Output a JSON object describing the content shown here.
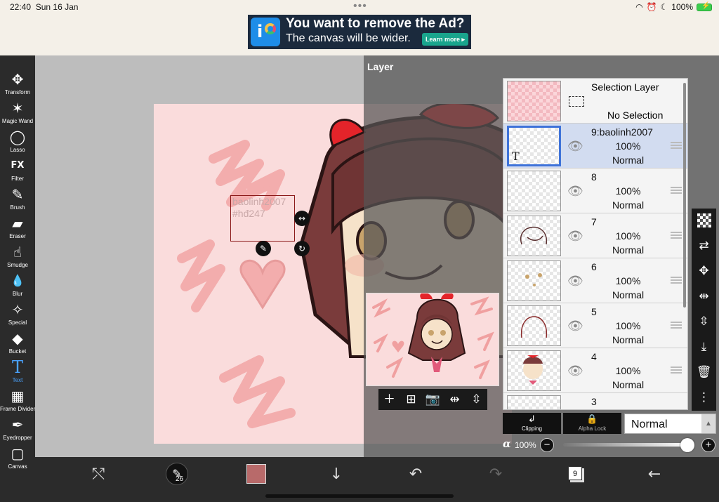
{
  "status": {
    "time": "22:40",
    "date": "Sun 16 Jan",
    "battery": "100%"
  },
  "ad": {
    "title": "You want to remove the Ad?",
    "subtitle": "The canvas will be wider.",
    "button": "Learn more ▸"
  },
  "tools": [
    {
      "label": "Transform",
      "icon": "✥"
    },
    {
      "label": "Magic Wand",
      "icon": "✶"
    },
    {
      "label": "Lasso",
      "icon": "◯"
    },
    {
      "label": "Filter",
      "icon": "FX"
    },
    {
      "label": "Brush",
      "icon": "✎"
    },
    {
      "label": "Eraser",
      "icon": "▰"
    },
    {
      "label": "Smudge",
      "icon": "☝"
    },
    {
      "label": "Blur",
      "icon": "💧"
    },
    {
      "label": "Special",
      "icon": "✧"
    },
    {
      "label": "Bucket",
      "icon": "◆"
    },
    {
      "label": "Text",
      "icon": "T"
    },
    {
      "label": "Frame Divider",
      "icon": "▦"
    },
    {
      "label": "Eyedropper",
      "icon": "✒"
    },
    {
      "label": "Canvas",
      "icon": "▢"
    }
  ],
  "canvas": {
    "text_line1": "baolinh2007",
    "text_line2": "#hđ247"
  },
  "layer_panel": {
    "title": "Layer",
    "selection_layer": {
      "name": "Selection Layer",
      "state": "No Selection"
    },
    "layers": [
      {
        "name": "9:baolinh2007",
        "opacity": "100%",
        "blend": "Normal"
      },
      {
        "name": "8",
        "opacity": "100%",
        "blend": "Normal"
      },
      {
        "name": "7",
        "opacity": "100%",
        "blend": "Normal"
      },
      {
        "name": "6",
        "opacity": "100%",
        "blend": "Normal"
      },
      {
        "name": "5",
        "opacity": "100%",
        "blend": "Normal"
      },
      {
        "name": "4",
        "opacity": "100%",
        "blend": "Normal"
      },
      {
        "name": "3",
        "opacity": "",
        "blend": ""
      }
    ],
    "clipping_label": "Clipping",
    "alpha_lock_label": "Alpha Lock",
    "blend_mode": "Normal",
    "opacity_symbol": "α",
    "opacity_value": "100%",
    "opacity_level": 1.0
  },
  "bottom": {
    "brush_size": "26",
    "color": "#b86a6a",
    "layer_count": "9"
  },
  "colors": {
    "accent": "#4aa3ff",
    "selection_blue": "#3f73d9"
  }
}
